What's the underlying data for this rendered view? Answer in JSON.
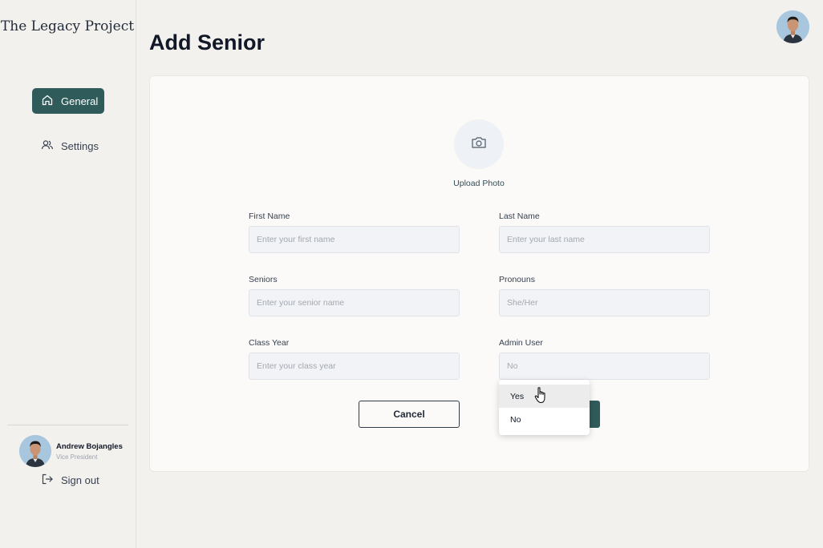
{
  "sidebar": {
    "brand": "The Legacy Project",
    "nav": [
      {
        "label": "General",
        "icon": "home-icon",
        "active": true
      },
      {
        "label": "Settings",
        "icon": "users-icon",
        "active": false
      }
    ],
    "profile": {
      "name": "Andrew Bojangles",
      "role": "Vice President"
    },
    "signout": "Sign out"
  },
  "header": {
    "title": "Add Senior"
  },
  "form": {
    "upload_label": "Upload Photo",
    "fields": {
      "first_name": {
        "label": "First Name",
        "placeholder": "Enter your first name"
      },
      "last_name": {
        "label": "Last Name",
        "placeholder": "Enter your last name"
      },
      "seniors": {
        "label": "Seniors",
        "placeholder": "Enter your senior name"
      },
      "pronouns": {
        "label": "Pronouns",
        "placeholder": "She/Her"
      },
      "class_year": {
        "label": "Class Year",
        "placeholder": "Enter your class year"
      },
      "admin_user": {
        "label": "Admin User",
        "placeholder": "No"
      }
    },
    "cancel_label": "Cancel",
    "admin_options": [
      "Yes",
      "No"
    ],
    "admin_highlighted": "Yes"
  },
  "colors": {
    "accent": "#2f5b5a",
    "background": "#f3f1ed",
    "card": "#fbfaf8"
  }
}
